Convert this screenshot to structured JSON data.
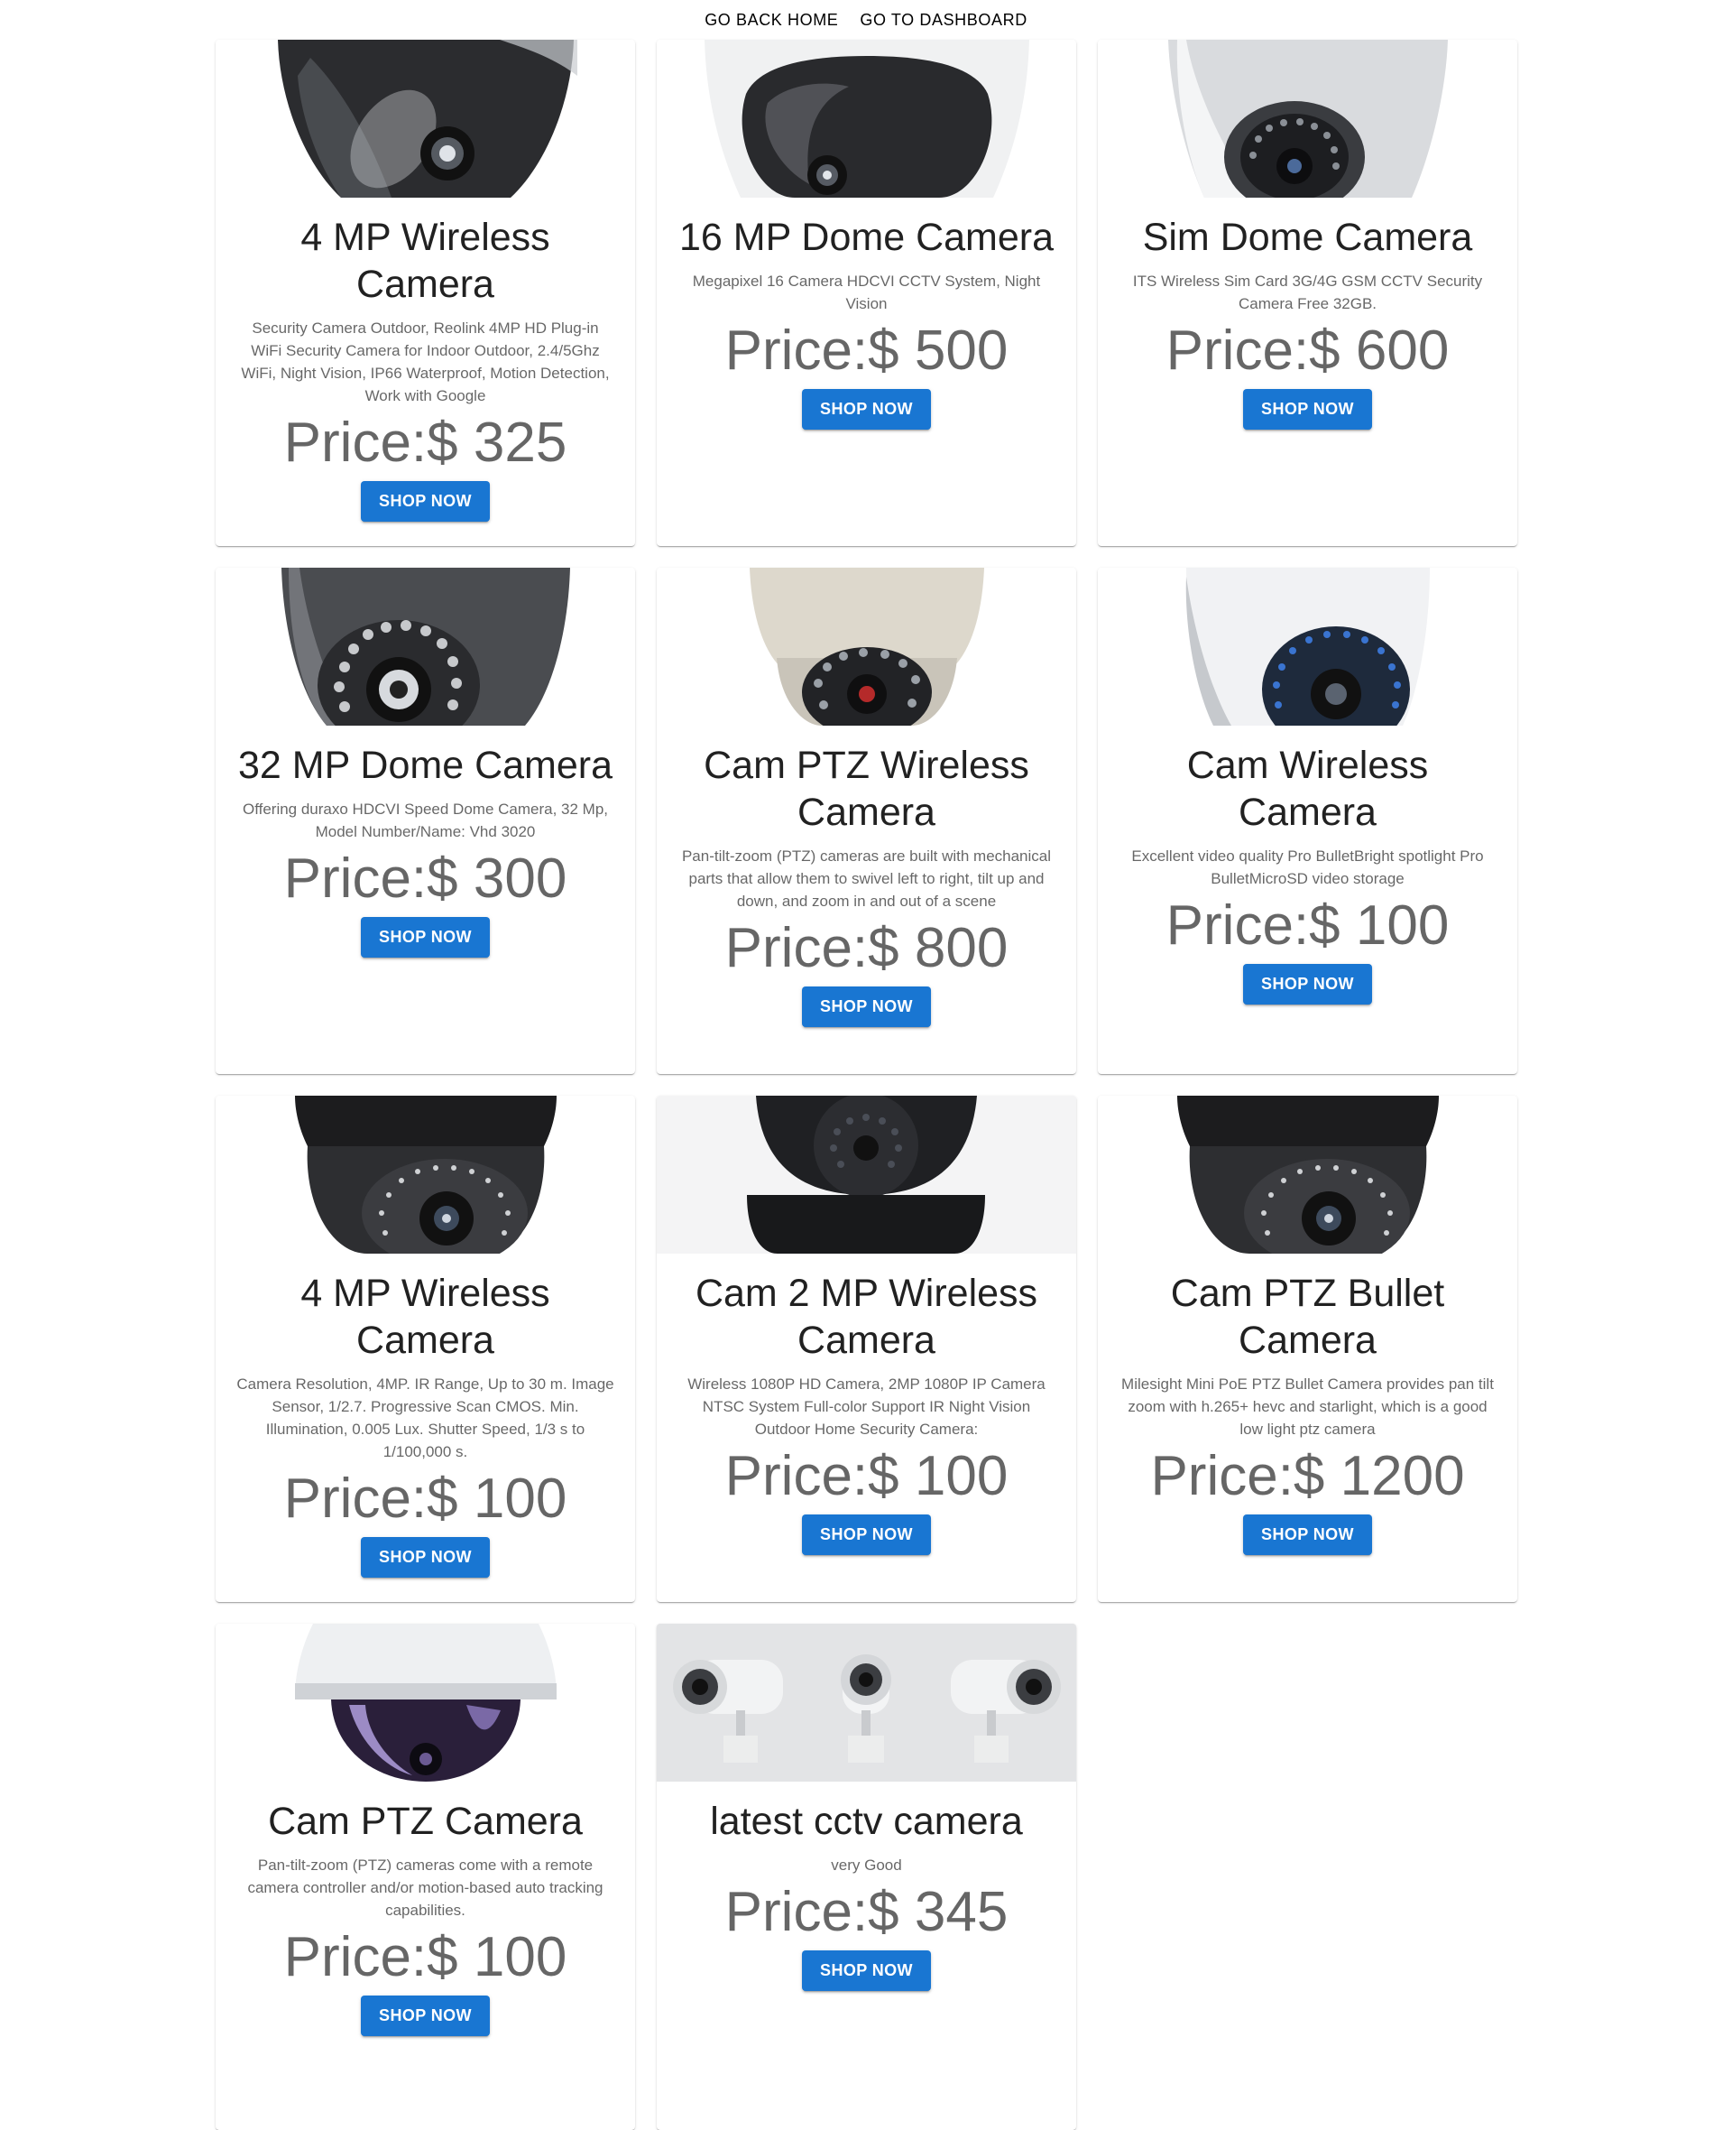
{
  "nav": {
    "home_label": "GO BACK HOME",
    "dashboard_label": "GO TO DASHBOARD"
  },
  "colors": {
    "primary": "#1976d2",
    "background": "#ffffff"
  },
  "products": [
    {
      "title": "4 MP Wireless Camera",
      "description": "Security Camera Outdoor, Reolink 4MP HD Plug-in WiFi Security Camera for Indoor Outdoor, 2.4/5Ghz WiFi, Night Vision, IP66 Waterproof, Motion Detection, Work with Google",
      "price": "Price:$ 325",
      "button": "SHOP NOW",
      "image": "dark-dome-camera"
    },
    {
      "title": "16 MP Dome Camera",
      "description": "Megapixel 16 Camera HDCVI CCTV System, Night Vision",
      "price": "Price:$ 500",
      "button": "SHOP NOW",
      "image": "white-dome-camera"
    },
    {
      "title": "Sim Dome Camera",
      "description": "ITS Wireless Sim Card 3G/4G GSM CCTV Security Camera Free 32GB.",
      "price": "Price:$ 600",
      "button": "SHOP NOW",
      "image": "silver-ir-dome-camera"
    },
    {
      "title": "32 MP Dome Camera",
      "description": "Offering duraxo HDCVI Speed Dome Camera, 32 Mp, Model Number/Name: Vhd 3020",
      "price": "Price:$ 300",
      "button": "SHOP NOW",
      "image": "grey-ir-dome-camera"
    },
    {
      "title": "Cam PTZ Wireless Camera",
      "description": "Pan-tilt-zoom (PTZ) cameras are built with mechanical parts that allow them to swivel left to right, tilt up and down, and zoom in and out of a scene",
      "price": "Price:$ 800",
      "button": "SHOP NOW",
      "image": "beige-ir-dome-camera"
    },
    {
      "title": "Cam Wireless Camera",
      "description": "Excellent video quality Pro BulletBright spotlight Pro BulletMicroSD video storage",
      "price": "Price:$ 100",
      "button": "SHOP NOW",
      "image": "white-turret-camera"
    },
    {
      "title": "4 MP Wireless Camera",
      "description": "Camera Resolution, 4MP. IR Range, Up to 30 m. Image Sensor, 1/2.7. Progressive Scan CMOS. Min. Illumination, 0.005 Lux. Shutter Speed, 1/3 s to 1/100,000 s.",
      "price": "Price:$ 100",
      "button": "SHOP NOW",
      "image": "black-turret-camera"
    },
    {
      "title": "Cam 2 MP Wireless Camera",
      "description": "Wireless 1080P HD Camera, 2MP 1080P IP Camera NTSC System Full-color Support IR Night Vision Outdoor Home Security Camera:",
      "price": "Price:$ 100",
      "button": "SHOP NOW",
      "image": "black-dome-camera"
    },
    {
      "title": "Cam PTZ Bullet Camera",
      "description": "Milesight Mini PoE PTZ Bullet Camera provides pan tilt zoom with h.265+ hevc and starlight, which is a good low light ptz camera",
      "price": "Price:$ 1200",
      "button": "SHOP NOW",
      "image": "black-turret-camera"
    },
    {
      "title": "Cam PTZ Camera",
      "description": "Pan-tilt-zoom (PTZ) cameras come with a remote camera controller and/or motion-based auto tracking capabilities.",
      "price": "Price:$ 100",
      "button": "SHOP NOW",
      "image": "white-dome-camera-violet"
    },
    {
      "title": "latest cctv camera",
      "description": "very Good",
      "price": "Price:$ 345",
      "button": "SHOP NOW",
      "image": "bullet-cameras-trio"
    }
  ]
}
